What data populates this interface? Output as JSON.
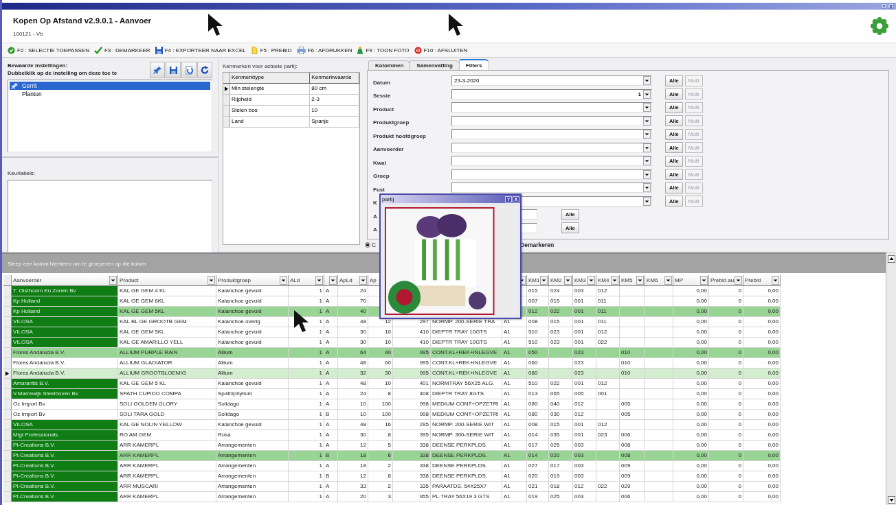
{
  "window": {
    "title": "Kopen Op Afstand v2.9.0.1 - Aanvoer",
    "subtitle": "100121 - Vb",
    "controls": [
      "?",
      "X"
    ]
  },
  "toolbar": [
    {
      "kind": "apply",
      "label": "F2 : SELECTIE TOEPASSEN"
    },
    {
      "kind": "unmark",
      "label": "F3 : DEMARKEER"
    },
    {
      "kind": "export",
      "label": "F4 : EXPORTEER NAAR EXCEL"
    },
    {
      "kind": "prebid",
      "label": "F5 : PREBID"
    },
    {
      "kind": "print",
      "label": "F6 : AFDRUKKEN"
    },
    {
      "label": "F9 : TOON FOTO"
    },
    {
      "kind": "close",
      "label": "F10 : AFSLUITEN"
    }
  ],
  "saved_settings": {
    "title": "Bewaarde instellingen:",
    "hint": "Dubbelklik op de instelling om deze toe te",
    "items": [
      {
        "label": "Gerrit",
        "selected": true
      },
      {
        "label": "Planton",
        "selected": false
      }
    ]
  },
  "quality_labels": {
    "title": "Keurlabels:"
  },
  "features": {
    "title": "Kenmerken voor actuele partij:",
    "columns": [
      "Kenmerktype",
      "Kenmerkwaarde"
    ],
    "rows": [
      {
        "cells": [
          "Min stelengte",
          "80 cm"
        ],
        "selected": true
      },
      {
        "cells": [
          "Rijpheid",
          "2-3"
        ],
        "selected": false
      },
      {
        "cells": [
          "Stelen bos",
          "10"
        ],
        "selected": false
      },
      {
        "cells": [
          "Land",
          "Spanje"
        ],
        "selected": false
      }
    ]
  },
  "tabs": [
    {
      "label": "Kolommen",
      "selected": false
    },
    {
      "label": "Samenvatting",
      "selected": false
    },
    {
      "label": "Filters",
      "selected": true
    }
  ],
  "filters": [
    {
      "kind": "combo",
      "label": "Datum",
      "value": "23-3-2020",
      "all": "Alle",
      "multi": {
        "label": "Multi",
        "disabled": true
      }
    },
    {
      "kind": "combo_number",
      "label": "Sessie",
      "value": "1",
      "all": "Alle",
      "multi": {
        "label": "Multi",
        "disabled": true
      }
    },
    {
      "kind": "combo",
      "label": "Product",
      "all": "Alle",
      "multi": {
        "label": "Multi",
        "disabled": true
      }
    },
    {
      "kind": "combo",
      "label": "Produktgroep",
      "all": "Alle",
      "multi": {
        "label": "Multi",
        "disabled": true
      }
    },
    {
      "kind": "combo",
      "label": "Produkt hoofdgroep",
      "all": "Alle",
      "multi": {
        "label": "Multi",
        "disabled": true
      }
    },
    {
      "kind": "combo",
      "label": "Aanvoerder",
      "all": "Alle",
      "multi": {
        "label": "Multi",
        "disabled": true
      }
    },
    {
      "kind": "combo",
      "label": "Kwal",
      "all": "Alle",
      "multi": {
        "label": "Multi",
        "disabled": true
      }
    },
    {
      "kind": "combo",
      "label": "Groep",
      "all": "Alle",
      "multi": {
        "label": "Multi",
        "disabled": true
      }
    },
    {
      "kind": "combo",
      "label": "Fust",
      "all": "Alle",
      "multi": {
        "label": "Multi",
        "disabled": true
      }
    },
    {
      "kind": "combo",
      "label": "K",
      "all": "Alle",
      "multi": {
        "label": "Multi",
        "disabled": true
      }
    },
    {
      "kind": "text",
      "label": "A",
      "all": "Alle"
    },
    {
      "kind": "text",
      "label": "A",
      "all": "Alle"
    }
  ],
  "mark_options": [
    {
      "label": "C",
      "selected": true
    }
  ],
  "demark_label": "Demarkeren",
  "grid": {
    "group_hint": "Sleep een kolom hierheen om te groeperen op die kolom",
    "columns": [
      {
        "label": "Aanvoerder",
        "filter": true
      },
      {
        "label": "Product",
        "filter": true
      },
      {
        "label": "Produktgroep",
        "filter": true
      },
      {
        "label": "ALd",
        "filter": true
      },
      {
        "filter": true
      },
      {
        "label": "ApLd",
        "filter": true
      },
      {
        "label": "Ap"
      },
      {},
      {},
      {
        "filter": true
      },
      {
        "label": "KM1",
        "filter": true
      },
      {
        "label": "KM2",
        "filter": true
      },
      {
        "label": "KM3",
        "filter": true
      },
      {
        "label": "KM4",
        "filter": true
      },
      {
        "label": "KM5",
        "filter": true
      },
      {
        "label": "KM6",
        "filter": true
      },
      {
        "label": "MP",
        "filter": true
      },
      {
        "label": "Prebid au",
        "filter": true
      },
      {
        "label": "Prebid",
        "filter": true
      }
    ],
    "rows": [
      {
        "highlighted": true,
        "marked": false,
        "selected": false,
        "cells": [
          "T. Olsthoorn En Zonen Bv",
          "KAL GE GEM 4 KL",
          "Kalanchoe gevuld",
          "1",
          "A",
          "24",
          null,
          null,
          null,
          null,
          "015",
          "024",
          "003",
          "012",
          null,
          null,
          "0,00",
          "0",
          "0,00"
        ]
      },
      {
        "highlighted": true,
        "marked": false,
        "selected": false,
        "cells": [
          "Kp Holland",
          "KAL GE GEM 6KL",
          "Kalanchoe gevuld",
          "1",
          "A",
          "70",
          null,
          null,
          null,
          null,
          "007",
          "015",
          "001",
          "011",
          null,
          null,
          "0,00",
          "0",
          "0,00"
        ]
      },
      {
        "highlighted": true,
        "marked": true,
        "selected": false,
        "cells": [
          "Kp Holland",
          "KAL GE GEM 5KL",
          "Kalanchoe gevuld",
          "1",
          "A",
          "40",
          null,
          null,
          null,
          null,
          "012",
          "022",
          "001",
          "011",
          null,
          null,
          "0,00",
          "0",
          "0,00"
        ]
      },
      {
        "highlighted": true,
        "marked": false,
        "selected": false,
        "cells": [
          "VILOSA",
          "KAL BL GE GROOTB GEM",
          "Kalanchoe overig",
          "1",
          "A",
          "48",
          "12",
          "297",
          "NORMP. 200-SERIE TRA",
          "A1",
          "008",
          "015",
          "001",
          "011",
          null,
          null,
          "0,00",
          "0",
          "0,00"
        ]
      },
      {
        "highlighted": true,
        "marked": false,
        "selected": false,
        "cells": [
          "VILOSA",
          "KAL GE GEM 5KL",
          "Kalanchoe gevuld",
          "1",
          "A",
          "30",
          "10",
          "410",
          "DIEPTR TRAY 10GTS",
          "A1",
          "510",
          "023",
          "001",
          "012",
          null,
          null,
          "0,00",
          "0",
          "0,00"
        ]
      },
      {
        "highlighted": true,
        "marked": false,
        "selected": false,
        "cells": [
          "VILOSA",
          "KAL GE AMARILLO YELL",
          "Kalanchoe gevuld",
          "1",
          "A",
          "30",
          "10",
          "410",
          "DIEPTR TRAY 10GTS",
          "A1",
          "510",
          "023",
          "001",
          "022",
          null,
          null,
          "0,00",
          "0",
          "0,00"
        ]
      },
      {
        "highlighted": false,
        "marked": true,
        "selected": false,
        "cells": [
          "Flores Andalucia B.V.",
          "ALLIUM PURPLE RAIN",
          "Allium",
          "1",
          "A",
          "64",
          "40",
          "995",
          "CONT.KL+REK+INLEGVE",
          "A1",
          "050",
          null,
          "023",
          null,
          "010",
          null,
          "0,00",
          "0",
          "0,00"
        ]
      },
      {
        "highlighted": false,
        "marked": false,
        "selected": false,
        "cells": [
          "Flores Andalucia B.V.",
          "ALLIUM GLADIATOR",
          "Allium",
          "1",
          "A",
          "48",
          "60",
          "995",
          "CONT.KL+REK+INLEGVE",
          "A1",
          "060",
          null,
          "023",
          null,
          "010",
          null,
          "0,00",
          "0",
          "0,00"
        ]
      },
      {
        "highlighted": false,
        "marked": false,
        "selected": true,
        "cells": [
          "Flores Andalucia B.V.",
          "ALLIUM GROOTBLOEMIG",
          "Allium",
          "1",
          "A",
          "32",
          "30",
          "995",
          "CONT.KL+REK+INLEGVE",
          "A1",
          "080",
          null,
          "023",
          null,
          "010",
          null,
          "0,00",
          "0",
          "0,00"
        ]
      },
      {
        "highlighted": true,
        "marked": false,
        "selected": false,
        "cells": [
          "Amarantis B.V.",
          "KAL GE GEM 5 KL",
          "Kalanchoe gevuld",
          "1",
          "A",
          "48",
          "10",
          "401",
          "NORMTRAY 56X25 ALG.",
          "A1",
          "510",
          "022",
          "001",
          "012",
          null,
          null,
          "0,00",
          "0",
          "0,00"
        ]
      },
      {
        "highlighted": true,
        "marked": false,
        "selected": false,
        "cells": [
          "V.Marrewijk Steelhoven Bv",
          "SPATH CUPIDO COMPA",
          "Spathiphyllum",
          "1",
          "A",
          "24",
          "8",
          "408",
          "DIEPTR TRAY 8GTS",
          "A1",
          "013",
          "065",
          "005",
          "001",
          null,
          null,
          "0,00",
          "0",
          "0,00"
        ]
      },
      {
        "highlighted": false,
        "marked": false,
        "selected": false,
        "cells": [
          "Oz Import Bv",
          "SOLI GOLDEN GLORY",
          "Solidago",
          "1",
          "A",
          "10",
          "100",
          "998",
          "MEDIUM CONT+OPZETRI",
          "A1",
          "080",
          "040",
          "012",
          null,
          "005",
          null,
          "0,00",
          "0",
          "0,00"
        ]
      },
      {
        "highlighted": false,
        "marked": false,
        "selected": false,
        "cells": [
          "Oz Import Bv",
          "SOLI TARA GOLD",
          "Solidago",
          "1",
          "B",
          "10",
          "100",
          "998",
          "MEDIUM CONT+OPZETRI",
          "A1",
          "080",
          "030",
          "012",
          null,
          "005",
          null,
          "0,00",
          "0",
          "0,00"
        ]
      },
      {
        "highlighted": true,
        "marked": false,
        "selected": false,
        "cells": [
          "VILOSA",
          "KAL GE NOLIN YELLOW",
          "Kalanchoe gevuld",
          "1",
          "A",
          "48",
          "16",
          "295",
          "NORMP. 200-SERIE WIT",
          "A1",
          "008",
          "015",
          "001",
          "012",
          null,
          null,
          "0,00",
          "0",
          "0,00"
        ]
      },
      {
        "highlighted": true,
        "marked": false,
        "selected": false,
        "cells": [
          "Migt Professionals",
          "RO AM GEM",
          "Rosa",
          "1",
          "A",
          "30",
          "8",
          "395",
          "NORMP. 300-SERIE WIT",
          "A1",
          "014",
          "035",
          "001",
          "023",
          "006",
          null,
          "0,00",
          "0",
          "0,00"
        ]
      },
      {
        "highlighted": true,
        "marked": false,
        "selected": false,
        "cells": [
          "Pt-Creations B.V.",
          "ARR KAMERPL",
          "Arrangementen",
          "1",
          "A",
          "12",
          "5",
          "338",
          "DEENSE PERKPLDS.",
          "A1",
          "017",
          "025",
          "003",
          null,
          "008",
          null,
          "0,00",
          "0",
          "0,00"
        ]
      },
      {
        "highlighted": true,
        "marked": true,
        "selected": false,
        "cells": [
          "Pt-Creations B.V.",
          "ARR KAMERPL",
          "Arrangementen",
          "1",
          "B",
          "18",
          "6",
          "338",
          "DEENSE PERKPLDS.",
          "A1",
          "014",
          "020",
          "003",
          null,
          "008",
          null,
          "0,00",
          "0",
          "0,00"
        ]
      },
      {
        "highlighted": true,
        "marked": false,
        "selected": false,
        "cells": [
          "Pt-Creations B.V.",
          "ARR KAMERPL",
          "Arrangementen",
          "1",
          "A",
          "18",
          "2",
          "338",
          "DEENSE PERKPLDS.",
          "A1",
          "027",
          "017",
          "003",
          null,
          "009",
          null,
          "0,00",
          "0",
          "0,00"
        ]
      },
      {
        "highlighted": true,
        "marked": false,
        "selected": false,
        "cells": [
          "Pt-Creations B.V.",
          "ARR KAMERPL",
          "Arrangementen",
          "1",
          "B",
          "12",
          "8",
          "338",
          "DEENSE PERKPLDS.",
          "A1",
          "020",
          "019",
          "003",
          null,
          "009",
          null,
          "0,00",
          "0",
          "0,00"
        ]
      },
      {
        "highlighted": true,
        "marked": false,
        "selected": false,
        "cells": [
          "Pt-Creations B.V.",
          "ARR MUSCARI",
          "Arrangementen",
          "1",
          "A",
          "33",
          "2",
          "335",
          "PARAATDS. 54X25X7",
          "A1",
          "021",
          "018",
          "012",
          "022",
          "029",
          null,
          "0,00",
          "0",
          "0,00"
        ]
      },
      {
        "highlighted": true,
        "marked": false,
        "selected": false,
        "cells": [
          "Pt-Creations B.V.",
          "ARR KAMERPL",
          "Arrangementen",
          "1",
          "A",
          "20",
          "3",
          "955",
          "PL.TRAY 56X19 3 GTS",
          "A1",
          "019",
          "025",
          "003",
          null,
          "006",
          null,
          "0,00",
          "0",
          "0,00"
        ]
      }
    ]
  },
  "photo_window": {
    "title": "partij",
    "controls": [
      "?",
      "X"
    ],
    "photo": {
      "kind": "picture"
    }
  }
}
